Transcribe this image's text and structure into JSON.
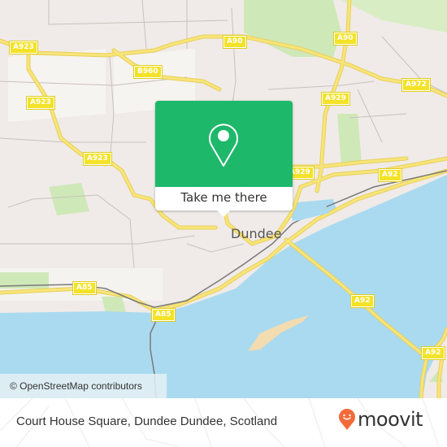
{
  "map": {
    "city_label": "Dundee",
    "road_labels": [
      {
        "id": "a923-1",
        "text": "A923"
      },
      {
        "id": "a923-2",
        "text": "A923"
      },
      {
        "id": "a923-3",
        "text": "A923"
      },
      {
        "id": "b960",
        "text": "B960"
      },
      {
        "id": "a90-1",
        "text": "A90"
      },
      {
        "id": "a90-2",
        "text": "A90"
      },
      {
        "id": "a972",
        "text": "A972"
      },
      {
        "id": "a929-1",
        "text": "A929"
      },
      {
        "id": "a929-2",
        "text": "A929"
      },
      {
        "id": "a92-1",
        "text": "A92"
      },
      {
        "id": "a92-2",
        "text": "A92"
      },
      {
        "id": "a92-3",
        "text": "A92"
      },
      {
        "id": "a85-1",
        "text": "A85"
      },
      {
        "id": "a85-2",
        "text": "A85"
      }
    ],
    "attribution": "© OpenStreetMap contributors",
    "colors": {
      "land": "#f0ebe8",
      "water": "#aadaef",
      "park": "#cfe8b8",
      "road_major": "#f7e57a",
      "sand": "#f3dcb0"
    }
  },
  "popup": {
    "icon": "location-pin-icon",
    "button_label": "Take me there",
    "color": "#1db86a"
  },
  "footer": {
    "title": "Court House Square, Dundee Dundee, Scotland",
    "brand": "moovit",
    "brand_icon": "moovit-smiley-pin-icon",
    "brand_color": "#f26b3a"
  }
}
